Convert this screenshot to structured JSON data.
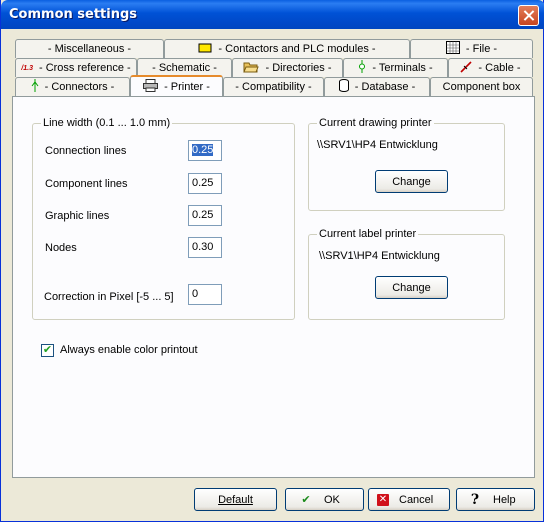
{
  "window": {
    "title": "Common settings"
  },
  "tabs": {
    "row1": [
      {
        "label": "- Miscellaneous -",
        "icon": ""
      },
      {
        "label": "- Contactors and PLC modules -",
        "icon": "contactor-icon"
      },
      {
        "label": "- File -",
        "icon": "file-grid-icon"
      }
    ],
    "row2": [
      {
        "label": "- Cross reference -",
        "icon": "cross-reference-icon"
      },
      {
        "label": "- Schematic -",
        "icon": ""
      },
      {
        "label": "- Directories -",
        "icon": "folder-open-icon"
      },
      {
        "label": "- Terminals -",
        "icon": "terminal-icon"
      },
      {
        "label": "- Cable -",
        "icon": "cable-icon"
      }
    ],
    "row3": [
      {
        "label": "- Connectors -",
        "icon": "connector-icon"
      },
      {
        "label": "- Printer -",
        "icon": "printer-icon"
      },
      {
        "label": "- Compatibility -",
        "icon": ""
      },
      {
        "label": "- Database -",
        "icon": "database-icon"
      },
      {
        "label": "Component box",
        "icon": ""
      }
    ],
    "active": "- Printer -"
  },
  "line_width": {
    "legend": "Line width  (0.1 ... 1.0 mm)",
    "fields": [
      {
        "label": "Connection lines",
        "value": "0.25"
      },
      {
        "label": "Component lines",
        "value": "0.25"
      },
      {
        "label": "Graphic lines",
        "value": "0.25"
      },
      {
        "label": "Nodes",
        "value": "0.30"
      },
      {
        "label": "Correction in Pixel [-5 ... 5]",
        "value": "0"
      }
    ]
  },
  "drawing_printer": {
    "legend": "Current drawing printer",
    "name": "\\\\SRV1\\HP4 Entwicklung",
    "button": "Change"
  },
  "label_printer": {
    "legend": "Current label printer",
    "name": "\\\\SRV1\\HP4 Entwicklung",
    "button": "Change"
  },
  "color_printout": {
    "label": "Always enable color printout",
    "checked": true
  },
  "footer": {
    "default_label": "Default",
    "ok_label": "OK",
    "cancel_label": "Cancel",
    "help_label": "Help"
  }
}
